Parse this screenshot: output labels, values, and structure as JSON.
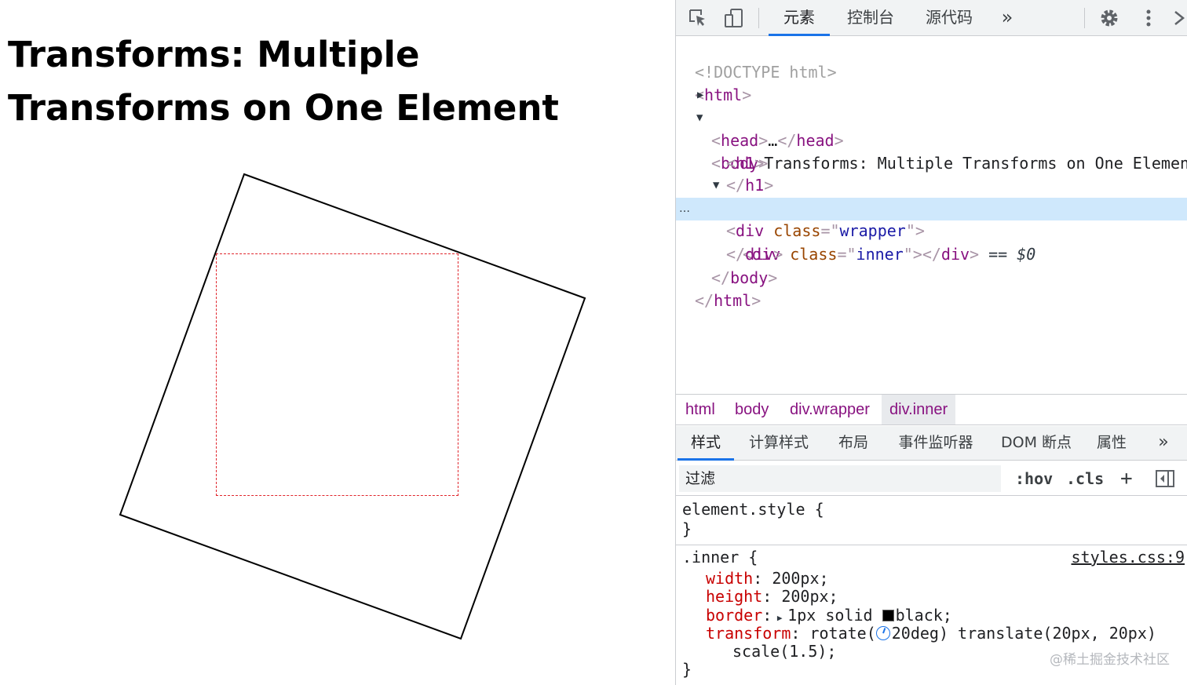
{
  "preview": {
    "title": "Transforms: Multiple Transforms on One Element"
  },
  "toolbar": {
    "tabs": [
      "元素",
      "控制台",
      "源代码"
    ],
    "more": "»"
  },
  "dom": {
    "doctype": "<!DOCTYPE html>",
    "html_open": "html",
    "head": "head",
    "head_ellipsis": "…",
    "body": "body",
    "h1": "h1",
    "h1_text": "Transforms: Multiple Transforms on One Element",
    "div": "div",
    "class_attr": "class",
    "wrapper_class": "wrapper",
    "inner_class": "inner",
    "selected_marker": "== $0",
    "ellipsis": "…"
  },
  "breadcrumbs": [
    "html",
    "body",
    "div.wrapper",
    "div.inner"
  ],
  "sub_tabs": [
    "样式",
    "计算样式",
    "布局",
    "事件监听器",
    "DOM 断点",
    "属性"
  ],
  "sub_tabs_more": "»",
  "filter": {
    "placeholder": "过滤",
    "hov": ":hov",
    "cls": ".cls",
    "add": "+"
  },
  "styles": {
    "element_style_selector": "element.style {",
    "close_brace": "}",
    "rule_selector": ".inner {",
    "rule_source": "styles.css:9",
    "props": [
      {
        "name": "width",
        "value": "200px;"
      },
      {
        "name": "height",
        "value": "200px;"
      },
      {
        "name": "border",
        "value": "1px solid",
        "color_name": "black;"
      },
      {
        "name": "transform",
        "value_pre": "rotate(",
        "value_post": "20deg) translate(20px, 20px)",
        "value_cont": "scale(1.5);"
      }
    ]
  },
  "watermark": "@稀土掘金技术社区",
  "colors": {
    "dashed_box": "#e0242b",
    "selected_row": "#cfe8fc",
    "active_tab": "#1a73e8",
    "tag": "#881280",
    "property": "#c80000"
  }
}
